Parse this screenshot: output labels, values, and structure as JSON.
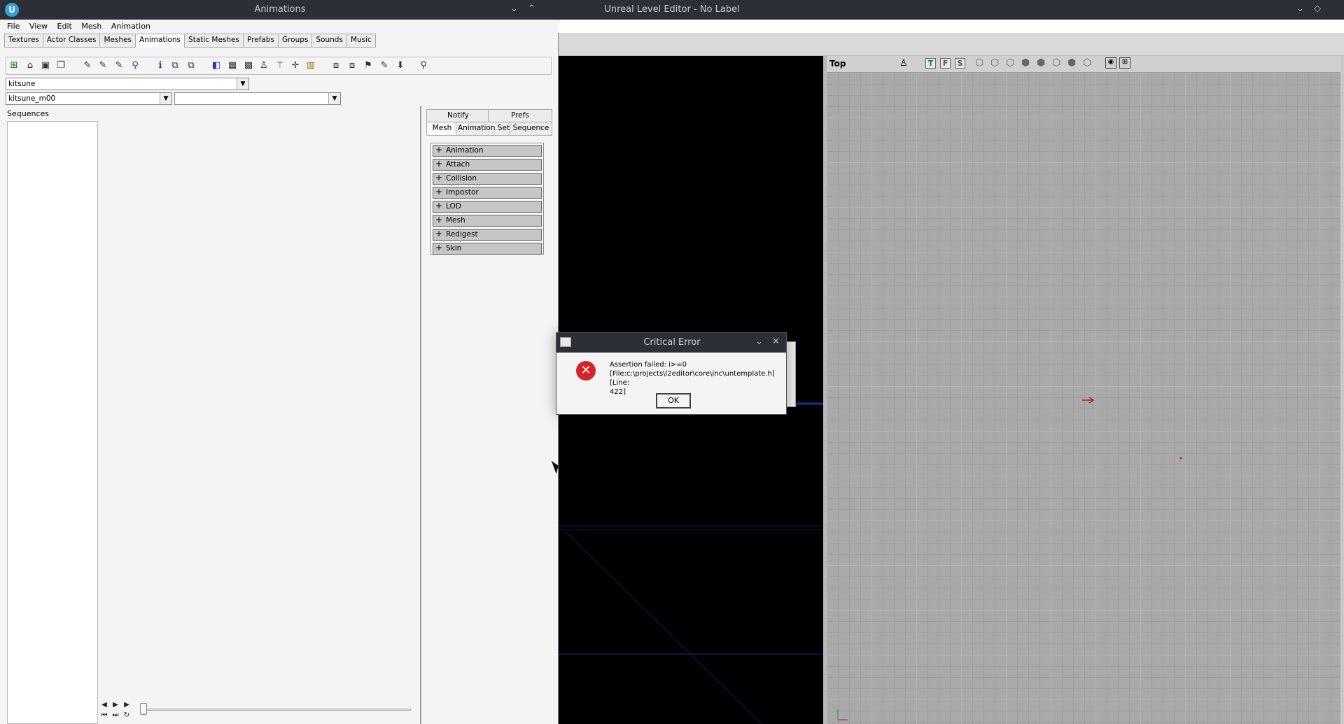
{
  "editor": {
    "title": "Unreal Level Editor - No Label",
    "controls": {
      "minimize": "⌄",
      "restore": "◇"
    },
    "top_viewport": {
      "label": "Top",
      "toolbar_letters": [
        "T",
        "F",
        "S"
      ]
    }
  },
  "animations_window": {
    "title": "Animations",
    "controls": {
      "minimize": "⌄",
      "maximize": "⌃"
    },
    "app_icon": "U",
    "menu": [
      "File",
      "View",
      "Edit",
      "Mesh",
      "Animation"
    ],
    "tabs": [
      "Textures",
      "Actor Classes",
      "Meshes",
      "Animations",
      "Static Meshes",
      "Prefabs",
      "Groups",
      "Sounds",
      "Music"
    ],
    "active_tab": "Animations",
    "combo_package": "kitsune",
    "combo_mesh": "kitsune_m00",
    "combo_third": "",
    "sequences_label": "Sequences",
    "panel_tabs_top": [
      "Notify",
      "Prefs"
    ],
    "panel_tabs_bottom": [
      "Mesh",
      "Animation Set",
      "Sequence"
    ],
    "properties": [
      "Animation",
      "Attach",
      "Collision",
      "Impostor",
      "LOD",
      "Mesh",
      "Redigest",
      "Skin"
    ]
  },
  "dialog": {
    "title": "Critical Error",
    "icon": "error-icon",
    "message_line1": "Assertion failed: i>=0",
    "message_line2": "[File:c:\\projects\\l2editor\\core\\inc\\untemplate.h] [Line:",
    "message_line3": "422]",
    "ok_label": "OK",
    "controls": {
      "minimize": "⌄",
      "close": "✕"
    }
  },
  "colors": {
    "titlebar": "#2c2f36",
    "error_red": "#d4242a",
    "grid": "#a9a9a9"
  }
}
